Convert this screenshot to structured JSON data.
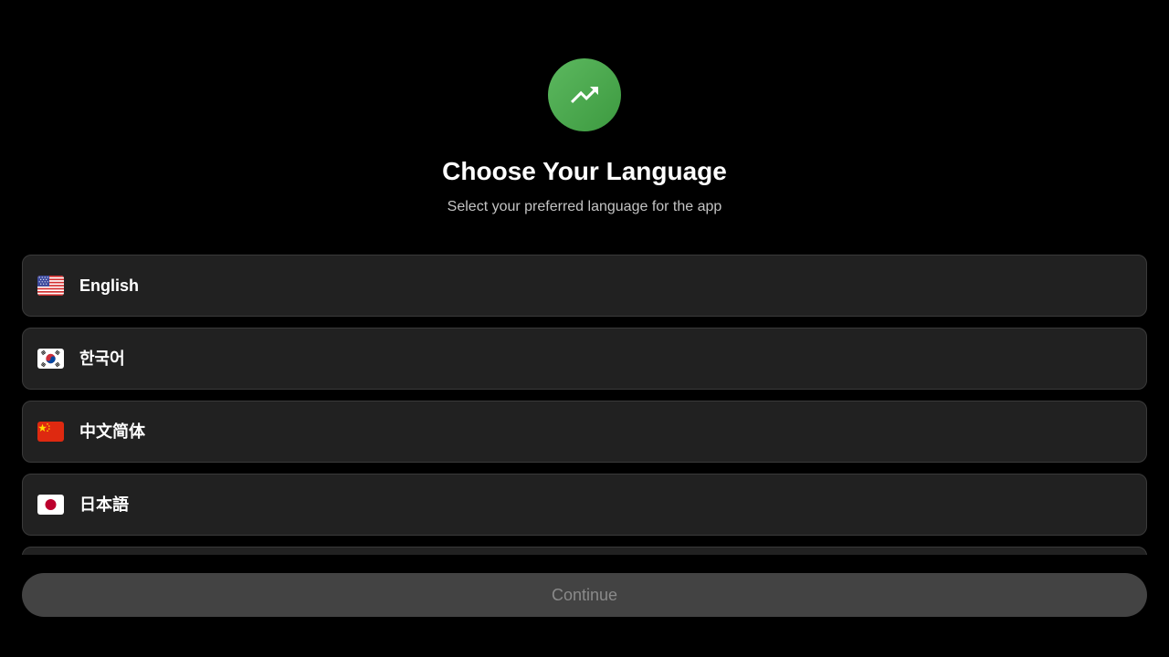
{
  "header": {
    "logo_icon": "trending-up-icon",
    "logo_color": "#4caf50",
    "title": "Choose Your Language",
    "subtitle": "Select your preferred language for the app"
  },
  "languages": [
    {
      "label": "English",
      "flag": "us-flag-icon"
    },
    {
      "label": "한국어",
      "flag": "kr-flag-icon"
    },
    {
      "label": "中文简体",
      "flag": "cn-flag-icon"
    },
    {
      "label": "日本語",
      "flag": "jp-flag-icon"
    }
  ],
  "footer": {
    "continue_label": "Continue",
    "continue_enabled": false
  },
  "colors": {
    "background": "#000000",
    "card": "#212121",
    "card_border": "#3a3a3a",
    "button_disabled": "#434343",
    "button_text_disabled": "#8a8a8a",
    "accent": "#4caf50"
  }
}
